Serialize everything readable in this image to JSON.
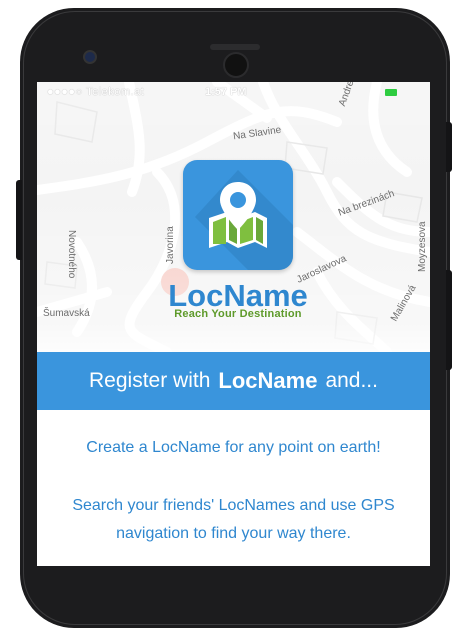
{
  "status_bar": {
    "carrier": "●●●●○ Telekom.at",
    "time": "1:57 PM",
    "wifi_icon": "wifi-icon",
    "battery_color": "#2ecc40"
  },
  "map": {
    "streets": [
      "Na Slavine",
      "Na brezinách",
      "Novotného",
      "Moyzesova",
      "Andre",
      "Javorina",
      "Jaroslavova",
      "Šumavská",
      "Malinová"
    ]
  },
  "logo": {
    "name": "LocName",
    "tagline": "Reach Your Destination",
    "icon": "map-pin-icon",
    "brand_color": "#3a95dd",
    "tagline_color": "#5e9a2a"
  },
  "banner": {
    "prefix": "Register with",
    "brand": "LocName",
    "suffix": "and..."
  },
  "features": [
    "Create a LocName for any point on earth!",
    "Search your friends' LocNames and use GPS navigation to find your way there."
  ],
  "colors": {
    "accent": "#3a95dd",
    "text_blue": "#2f87cf"
  }
}
